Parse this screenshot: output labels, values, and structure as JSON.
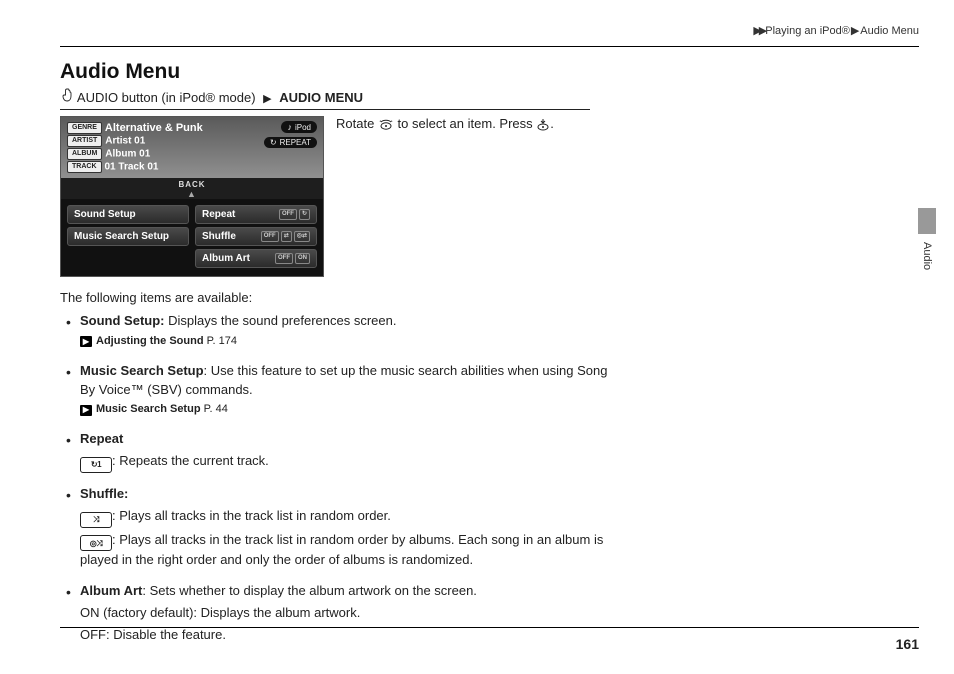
{
  "breadcrumb": {
    "section1": "Playing an iPod®",
    "section2": "Audio Menu"
  },
  "title": "Audio Menu",
  "subline": {
    "pre": " AUDIO button (in iPod® mode) ",
    "post": "AUDIO MENU"
  },
  "instruction": {
    "pre": "Rotate ",
    "mid": " to select an item. Press ",
    "post": "."
  },
  "sidetab": "Audio",
  "pagenum": "161",
  "shot": {
    "genre": "Alternative & Punk",
    "artist": "Artist 01",
    "album": "Album 01",
    "track": "01 Track 01",
    "badge_ipod": "iPod",
    "badge_repeat": "REPEAT",
    "back": "BACK",
    "tag": {
      "genre": "GENRE",
      "artist": "ARTIST",
      "album": "ALBUM",
      "track": "TRACK"
    },
    "menu": {
      "sound": "Sound Setup",
      "repeat": "Repeat",
      "mss": "Music Search Setup",
      "shuffle": "Shuffle",
      "albumart": "Album Art",
      "off": "OFF",
      "on": "ON"
    }
  },
  "intro": "The following items are available:",
  "items": {
    "sound": {
      "label": "Sound Setup:",
      "desc": " Displays the sound preferences screen.",
      "xref": "Adjusting the Sound",
      "page": " P. 174"
    },
    "mss": {
      "label": "Music Search Setup",
      "desc": ": Use this feature to set up the music search abilities when using Song By Voice™ (SBV) commands.",
      "xref": "Music Search Setup",
      "page": " P. 44"
    },
    "repeat": {
      "label": "Repeat",
      "l1": ": Repeats the current track."
    },
    "shuffle": {
      "label": "Shuffle:",
      "l1": ": Plays all tracks in the track list in random order.",
      "l2": ": Plays all tracks in the track list in random order by albums. Each song in an album is played in the right order and only the order of albums is randomized."
    },
    "albumart": {
      "label": "Album Art",
      "desc": ": Sets whether to display the album artwork on the screen.",
      "on_label": "ON",
      "on": " (factory default): Displays the album artwork.",
      "off_label": "OFF",
      "off": ": Disable the feature."
    }
  }
}
